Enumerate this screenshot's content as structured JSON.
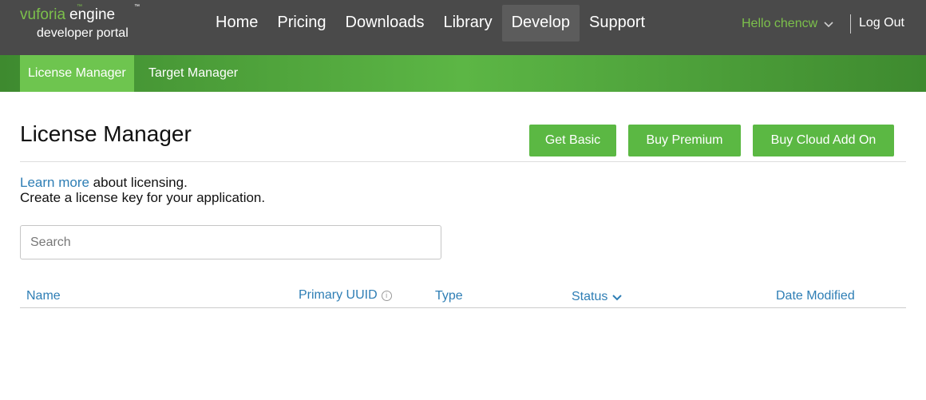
{
  "header": {
    "logo": {
      "brand": "vuforia",
      "tm": "™",
      "product": "engine",
      "product_tm": "™",
      "subtitle": "developer portal"
    },
    "nav": [
      {
        "label": "Home",
        "active": false
      },
      {
        "label": "Pricing",
        "active": false
      },
      {
        "label": "Downloads",
        "active": false
      },
      {
        "label": "Library",
        "active": false
      },
      {
        "label": "Develop",
        "active": true
      },
      {
        "label": "Support",
        "active": false
      }
    ],
    "user_greeting": "Hello chencw",
    "logout_label": "Log Out"
  },
  "subnav": {
    "tabs": [
      {
        "label": "License Manager",
        "active": true
      },
      {
        "label": "Target Manager",
        "active": false
      }
    ]
  },
  "main": {
    "title": "License Manager",
    "buttons": {
      "get_basic": "Get Basic",
      "buy_premium": "Buy Premium",
      "buy_cloud": "Buy Cloud Add On"
    },
    "learn_more_link": "Learn more",
    "learn_more_rest": " about licensing.",
    "create_text": "Create a license key for your application.",
    "search": {
      "placeholder": "Search",
      "value": ""
    },
    "table": {
      "columns": [
        "Name",
        "Primary UUID",
        "Type",
        "Status",
        "Date Modified"
      ],
      "rows": []
    }
  },
  "colors": {
    "brand_green": "#7cc04b",
    "button_green": "#5bb843",
    "link_blue": "#2e7eb5",
    "topbar": "#4a4a4a"
  },
  "icons": {
    "user_menu": "chevron-down-icon",
    "info": "info-icon",
    "sort": "chevron-down-icon"
  }
}
